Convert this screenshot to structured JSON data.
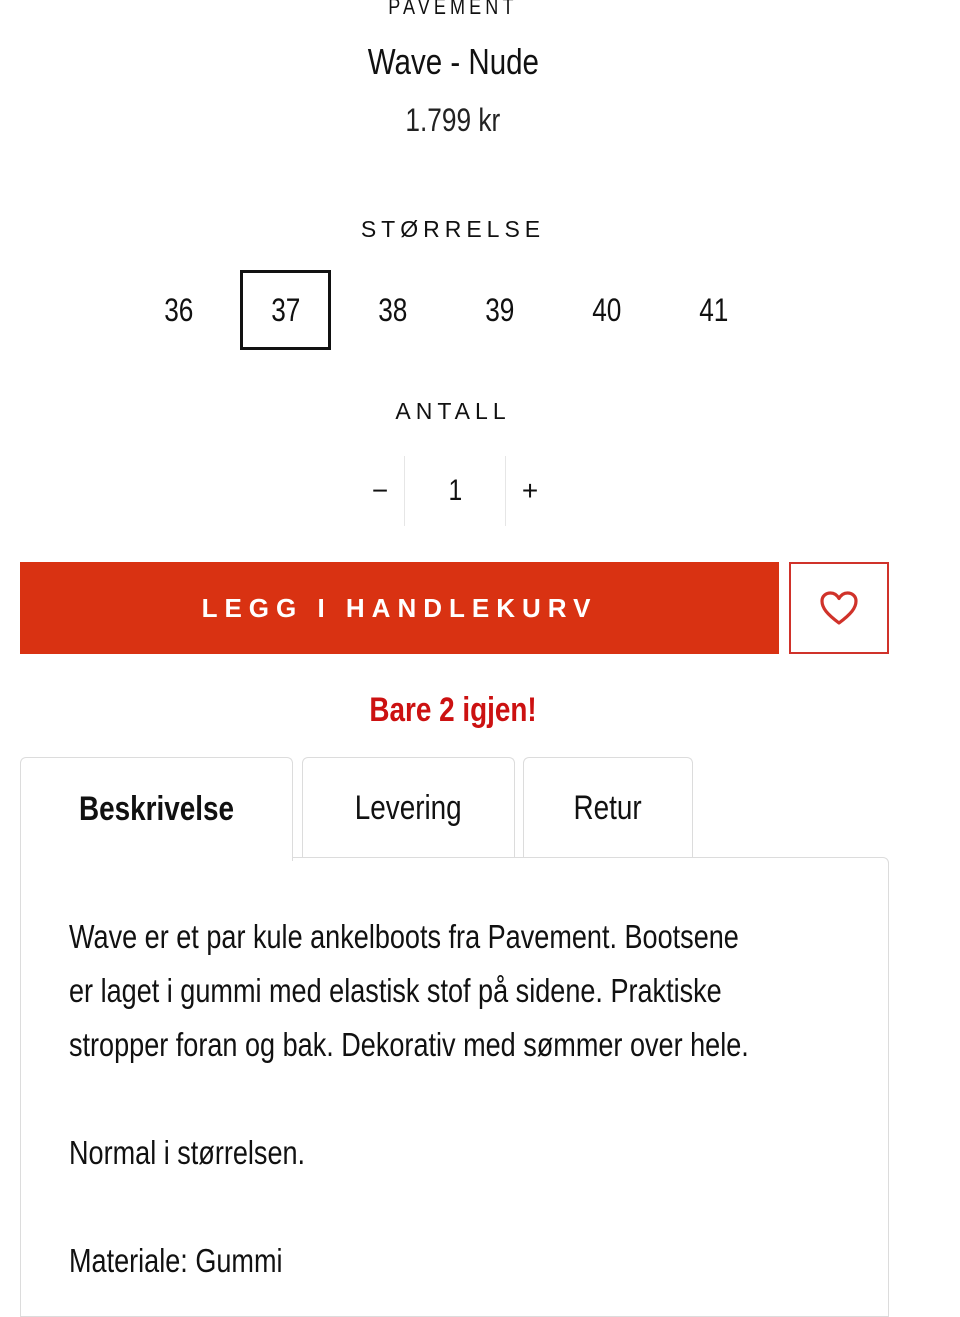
{
  "product": {
    "brand": "PAVEMENT",
    "title": "Wave - Nude",
    "price": "1.799 kr"
  },
  "size": {
    "label": "STØRRELSE",
    "options": [
      "36",
      "37",
      "38",
      "39",
      "40",
      "41"
    ],
    "selected": "37"
  },
  "quantity": {
    "label": "ANTALL",
    "value": "1",
    "minus": "−",
    "plus": "+"
  },
  "actions": {
    "add_to_cart": "LEGG I HANDLEKURV",
    "wishlist_icon": "heart-icon",
    "wishlist_color": "#d0322a"
  },
  "stock_message": "Bare 2 igjen!",
  "colors": {
    "accent": "#d93212",
    "stock_text": "#cc1111"
  },
  "tabs": [
    {
      "label": "Beskrivelse",
      "active": true
    },
    {
      "label": "Levering",
      "active": false
    },
    {
      "label": "Retur",
      "active": false
    }
  ],
  "description": {
    "lines": [
      "Wave er et par kule ankelboots fra Pavement. Bootsene",
      "er laget i gummi med elastisk stof på sidene. Praktiske",
      "stropper foran og bak. Dekorativ med sømmer over hele."
    ],
    "fit": "Normal i størrelsen.",
    "material": "Materiale: Gummi"
  }
}
